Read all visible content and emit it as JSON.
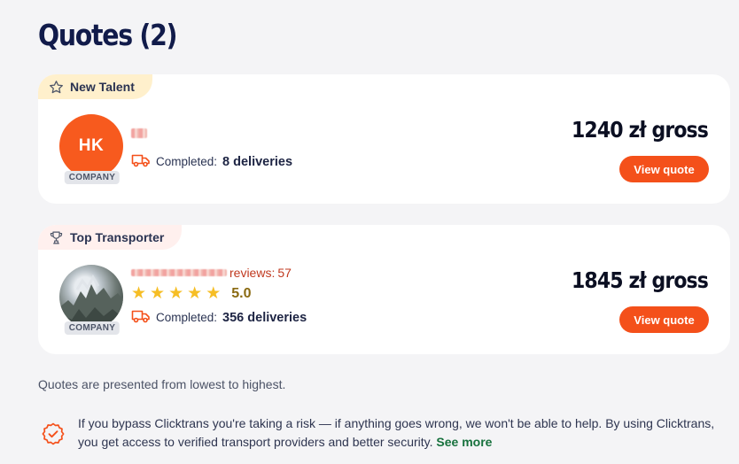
{
  "page": {
    "title": "Quotes (2)"
  },
  "quotes": [
    {
      "badge": "New Talent",
      "badge_icon": "star-outline-icon",
      "avatar_initials": "HK",
      "company_label": "COMPANY",
      "completed_label": "Completed:",
      "completed_value": "8 deliveries",
      "price": "1240 zł gross",
      "button_label": "View quote"
    },
    {
      "badge": "Top Transporter",
      "badge_icon": "trophy-icon",
      "company_label": "COMPANY",
      "reviews_label": "reviews:",
      "reviews_count": "57",
      "rating_stars": 5,
      "rating": "5.0",
      "completed_label": "Completed:",
      "completed_value": "356 deliveries",
      "price": "1845 zł gross",
      "button_label": "View quote"
    }
  ],
  "footer": {
    "note": "Quotes are presented from lowest to highest.",
    "warning": "If you bypass Clicktrans you're taking a risk — if anything goes wrong, we won't be able to help. By using Clicktrans, you get access to verified transport providers and better security.",
    "see_more": "See more"
  },
  "colors": {
    "accent": "#f4501a",
    "title": "#111b4a",
    "star": "#f6be25",
    "link": "#17713d",
    "new_talent_badge": "#fff0cc",
    "top_transporter_badge": "#fff0ee"
  }
}
